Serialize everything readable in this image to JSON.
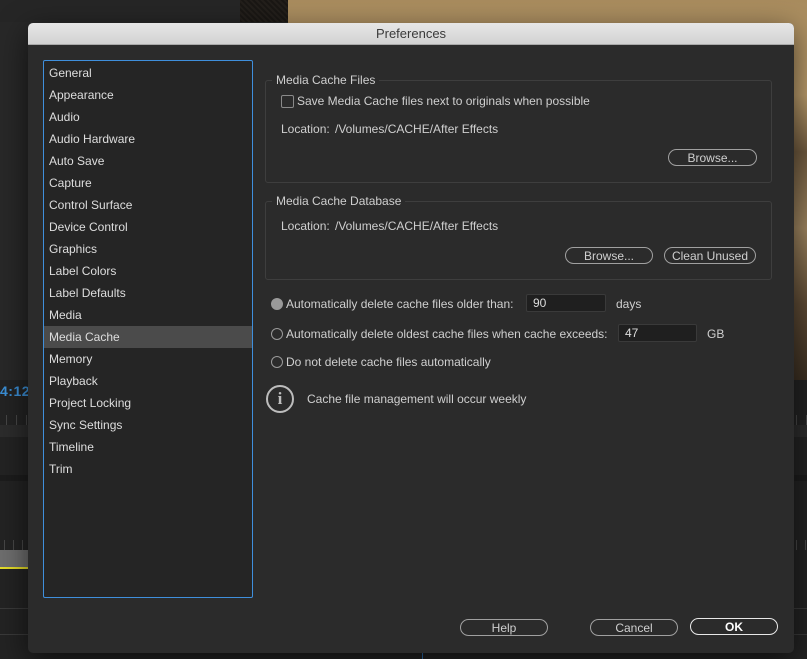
{
  "background": {
    "timecode": "4:12"
  },
  "dialog": {
    "title": "Preferences",
    "sidebar": {
      "items": [
        {
          "label": "General"
        },
        {
          "label": "Appearance"
        },
        {
          "label": "Audio"
        },
        {
          "label": "Audio Hardware"
        },
        {
          "label": "Auto Save"
        },
        {
          "label": "Capture"
        },
        {
          "label": "Control Surface"
        },
        {
          "label": "Device Control"
        },
        {
          "label": "Graphics"
        },
        {
          "label": "Label Colors"
        },
        {
          "label": "Label Defaults"
        },
        {
          "label": "Media"
        },
        {
          "label": "Media Cache",
          "selected": true
        },
        {
          "label": "Memory"
        },
        {
          "label": "Playback"
        },
        {
          "label": "Project Locking"
        },
        {
          "label": "Sync Settings"
        },
        {
          "label": "Timeline"
        },
        {
          "label": "Trim"
        }
      ]
    },
    "media_cache_files": {
      "title": "Media Cache Files",
      "save_next_to_originals": {
        "label": "Save Media Cache files next to originals when possible",
        "checked": false
      },
      "location_label": "Location:",
      "location_value": "/Volumes/CACHE/After Effects",
      "browse_label": "Browse..."
    },
    "media_cache_database": {
      "title": "Media Cache Database",
      "location_label": "Location:",
      "location_value": "/Volumes/CACHE/After Effects",
      "browse_label": "Browse...",
      "clean_unused_label": "Clean Unused"
    },
    "cache_management": {
      "options": [
        {
          "label": "Automatically delete cache files older than:",
          "value": "90",
          "unit": "days",
          "selected": true
        },
        {
          "label": "Automatically delete oldest cache files when cache exceeds:",
          "value": "47",
          "unit": "GB",
          "selected": false
        },
        {
          "label": "Do not delete cache files automatically",
          "selected": false
        }
      ],
      "info_text": "Cache file management will occur weekly"
    },
    "footer": {
      "help_label": "Help",
      "cancel_label": "Cancel",
      "ok_label": "OK"
    }
  }
}
